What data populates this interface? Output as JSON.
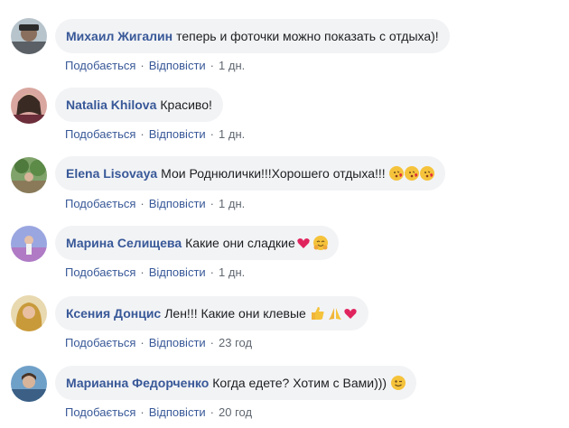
{
  "comments": [
    {
      "author": "Михаил Жигалин",
      "text": "теперь и фоточки можно показать с отдыха)!",
      "like": "Подобається",
      "reply": "Відповісти",
      "time": "1 дн.",
      "emojis": []
    },
    {
      "author": "Natalia Khilova",
      "text": "Красиво!",
      "like": "Подобається",
      "reply": "Відповісти",
      "time": "1 дн.",
      "emojis": []
    },
    {
      "author": "Elena Lisovaya",
      "text": "Мои Роднюлички!!!Хорошего отдыха!!!",
      "like": "Подобається",
      "reply": "Відповісти",
      "time": "1 дн.",
      "emojis": [
        "kissing-heart-emoji",
        "kissing-heart-emoji",
        "kissing-heart-emoji"
      ]
    },
    {
      "author": "Марина Селищева",
      "text": "Какие они сладкие",
      "like": "Подобається",
      "reply": "Відповісти",
      "time": "1 дн.",
      "emojis": [
        "heart-emoji",
        "hugging-emoji"
      ]
    },
    {
      "author": "Ксения Донцис",
      "text": "Лен!!! Какие они клевые",
      "like": "Подобається",
      "reply": "Відповісти",
      "time": "23 год",
      "emojis": [
        "thumbs-up-emoji",
        "praying-hands-emoji",
        "heart-emoji"
      ]
    },
    {
      "author": "Марианна Федорченко",
      "text": "Когда едете? Хотим с Вами)))",
      "like": "Подобається",
      "reply": "Відповісти",
      "time": "20 год",
      "emojis": [
        "wink-emoji"
      ]
    }
  ],
  "colors": {
    "author": "#385898",
    "bubble": "#f2f3f5",
    "meta": "#606770"
  }
}
